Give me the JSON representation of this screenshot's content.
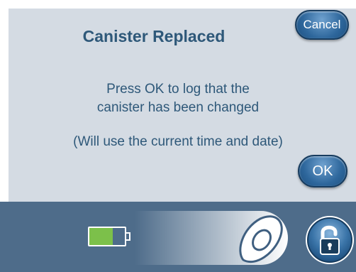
{
  "dialog": {
    "title": "Canister Replaced",
    "message_line1": "Press OK to log that the",
    "message_line2": "canister has been changed",
    "note": "(Will use the current time and date)"
  },
  "buttons": {
    "cancel_label": "Cancel",
    "ok_label": "OK"
  },
  "status_bar": {
    "battery_level": 0.65,
    "battery_color": "#7cc04a",
    "slider_icon": "unlock-slider-knob-icon",
    "lock_icon": "padlock-unlocked-icon"
  },
  "colors": {
    "dialog_bg": "#d4dbe3",
    "text": "#2e5879",
    "bar_bg": "#4e6c8a",
    "button": "#2e679c"
  }
}
